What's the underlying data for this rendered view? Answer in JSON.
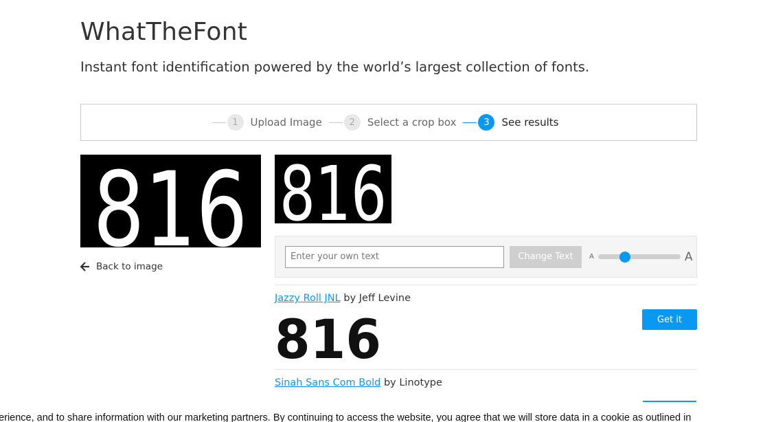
{
  "header": {
    "title": "WhatTheFont",
    "subtitle": "Instant font identification powered by the world’s largest collection of fonts."
  },
  "steps": [
    {
      "number": "1",
      "label": "Upload Image",
      "state": "done"
    },
    {
      "number": "2",
      "label": "Select a crop box",
      "state": "done"
    },
    {
      "number": "3",
      "label": "See results",
      "state": "active"
    }
  ],
  "source_image": {
    "text": "816"
  },
  "crop_image": {
    "text": "816"
  },
  "back_link": {
    "label": "Back to image",
    "icon": "arrow-left-icon"
  },
  "text_controls": {
    "placeholder": "Enter your own text",
    "button_label": "Change Text",
    "size_small_label": "A",
    "size_large_label": "A",
    "slider_value": 0.3
  },
  "results": [
    {
      "font_name": "Jazzy Roll JNL",
      "by": "by Jeff Levine",
      "sample": "816",
      "button_label": "Get it"
    },
    {
      "font_name": "Sinah Sans Com Bold",
      "by": "by Linotype",
      "sample": "",
      "button_label": ""
    }
  ],
  "cookie_text": "perience, and to share information with our marketing partners. By continuing to access the website, you agree that we will store data in a cookie as outlined in",
  "colors": {
    "accent": "#0a99f2",
    "text": "#333333",
    "border": "#cccccc"
  }
}
